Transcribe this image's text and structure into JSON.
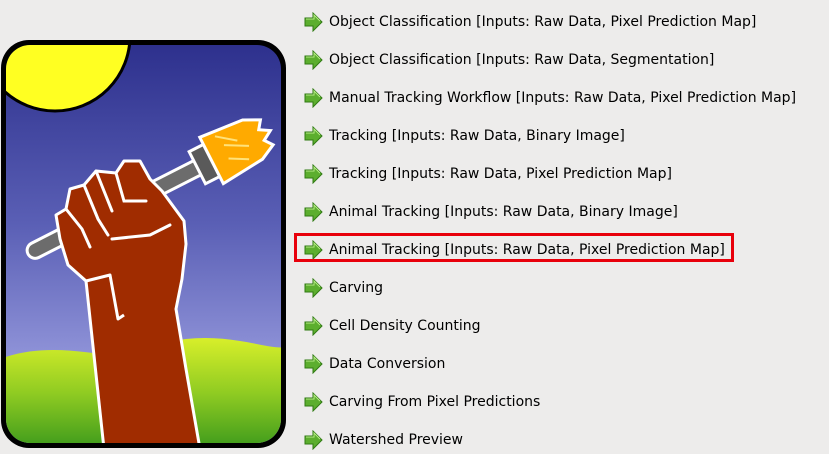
{
  "app": {
    "logo_icon": "ilastik-fist-paintbrush-logo"
  },
  "workflows": {
    "selected_index": 6,
    "arrow_icon": "green-arrow-right-icon",
    "arrow_color": "#5cae2e",
    "highlight_color": "#e8000b",
    "items": [
      {
        "label": "Object Classification [Inputs: Raw Data, Pixel Prediction Map]"
      },
      {
        "label": "Object Classification [Inputs: Raw Data, Segmentation]"
      },
      {
        "label": "Manual Tracking Workflow [Inputs: Raw Data, Pixel Prediction Map]"
      },
      {
        "label": "Tracking [Inputs: Raw Data, Binary Image]"
      },
      {
        "label": "Tracking [Inputs: Raw Data, Pixel Prediction Map]"
      },
      {
        "label": "Animal Tracking [Inputs: Raw Data, Binary Image]"
      },
      {
        "label": "Animal Tracking [Inputs: Raw Data, Pixel Prediction Map]"
      },
      {
        "label": "Carving"
      },
      {
        "label": "Cell Density Counting"
      },
      {
        "label": "Data Conversion"
      },
      {
        "label": "Carving From Pixel Predictions"
      },
      {
        "label": "Watershed Preview"
      }
    ]
  }
}
